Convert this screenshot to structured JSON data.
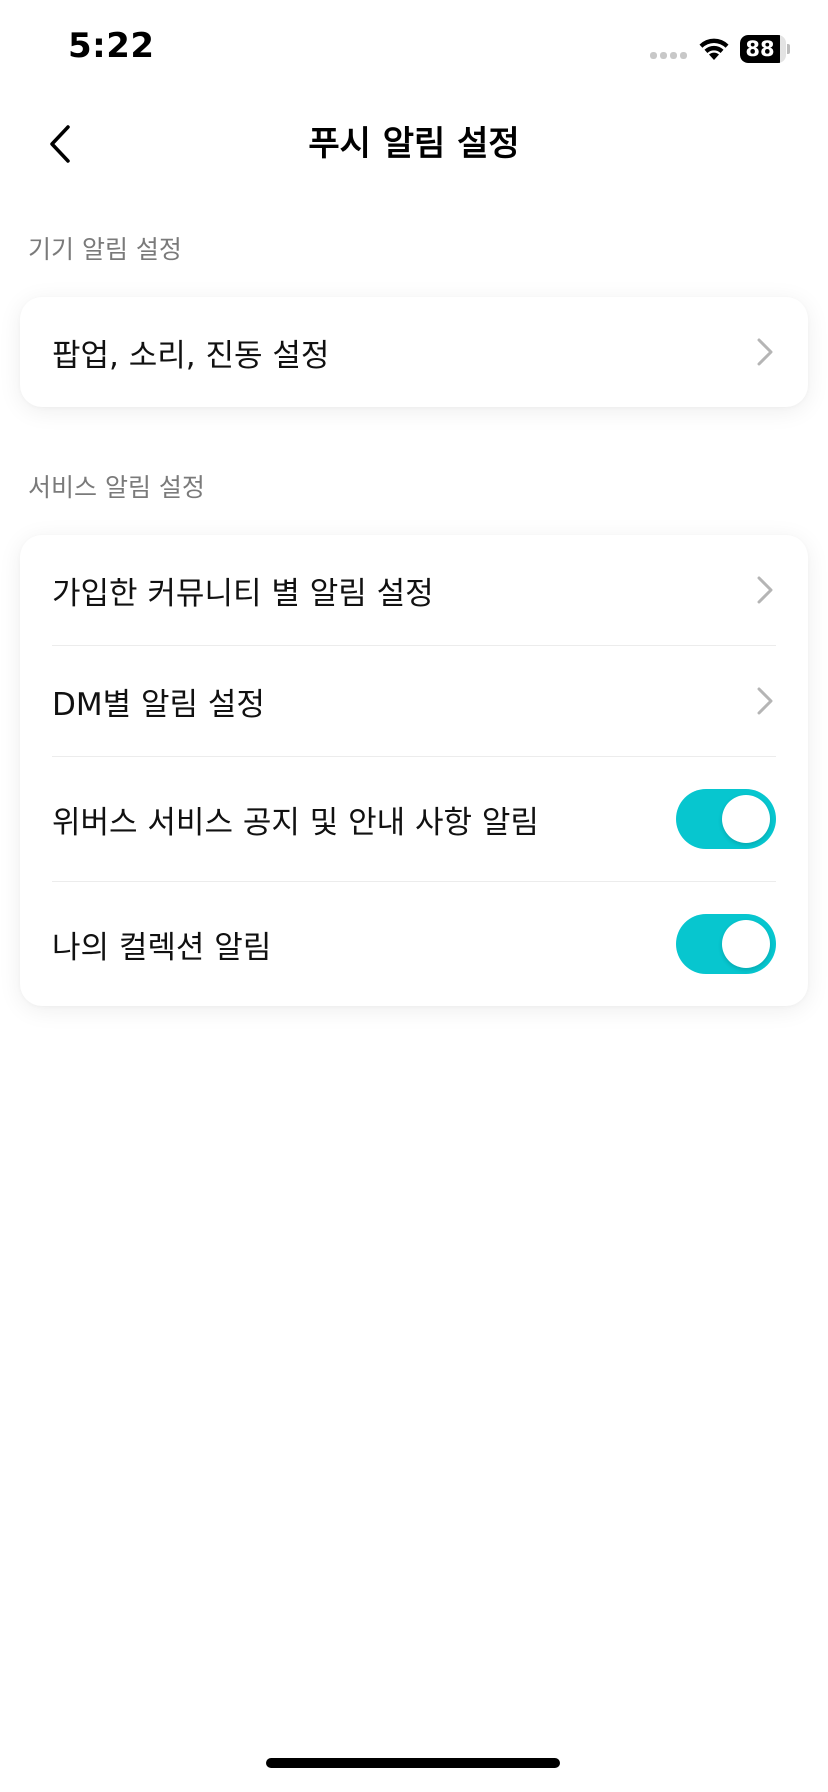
{
  "status_bar": {
    "time": "5:22",
    "battery_level": "88",
    "icons": [
      "signal-icon",
      "wifi-icon",
      "battery-icon"
    ]
  },
  "header": {
    "title": "푸시 알림 설정",
    "back_icon": "chevron-left-icon"
  },
  "sections": [
    {
      "label": "기기 알림 설정",
      "items": [
        {
          "label": "팝업, 소리, 진동 설정",
          "type": "link"
        }
      ]
    },
    {
      "label": "서비스 알림 설정",
      "items": [
        {
          "label": "가입한 커뮤니티 별 알림 설정",
          "type": "link"
        },
        {
          "label": "DM별 알림 설정",
          "type": "link"
        },
        {
          "label": "위버스 서비스 공지 및 안내 사항 알림",
          "type": "toggle",
          "on": true
        },
        {
          "label": "나의 컬렉션 알림",
          "type": "toggle",
          "on": true
        }
      ]
    }
  ],
  "colors": {
    "accent": "#07C6CF",
    "chevron": "#b5b5b5",
    "section_label": "#7a7a7a",
    "divider": "#ececec"
  }
}
